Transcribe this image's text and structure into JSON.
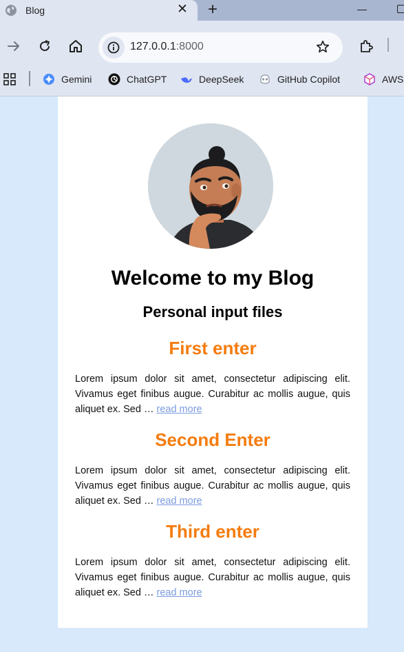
{
  "browser": {
    "tab_title": "Blog",
    "url_host": "127.0.0.1",
    "url_port": ":8000",
    "bookmarks": [
      {
        "label": "Gemini",
        "icon": "gemini-icon"
      },
      {
        "label": "ChatGPT",
        "icon": "chatgpt-icon"
      },
      {
        "label": "DeepSeek",
        "icon": "deepseek-icon"
      },
      {
        "label": "GitHub Copilot",
        "icon": "copilot-icon"
      },
      {
        "label": "AWS",
        "icon": "aws-icon"
      }
    ]
  },
  "page": {
    "title": "Welcome to my Blog",
    "subtitle": "Personal input files",
    "posts": [
      {
        "title": "First enter",
        "excerpt": "Lorem ipsum dolor sit amet, consectetur adipiscing elit. Vivamus eget finibus augue. Curabitur ac mollis augue, quis aliquet ex. Sed … ",
        "link": "read more"
      },
      {
        "title": "Second Enter",
        "excerpt": "Lorem ipsum dolor sit amet, consectetur adipiscing elit. Vivamus eget finibus augue. Curabitur ac mollis augue, quis aliquet ex. Sed … ",
        "link": "read more"
      },
      {
        "title": "Third enter",
        "excerpt": "Lorem ipsum dolor sit amet, consectetur adipiscing elit. Vivamus eget finibus augue. Curabitur ac mollis augue, quis aliquet ex. Sed … ",
        "link": "read more"
      }
    ]
  },
  "colors": {
    "page_background": "#d7e9fb",
    "card_background": "#ffffff",
    "post_title": "#f57c0f",
    "link": "#7a9be0"
  }
}
